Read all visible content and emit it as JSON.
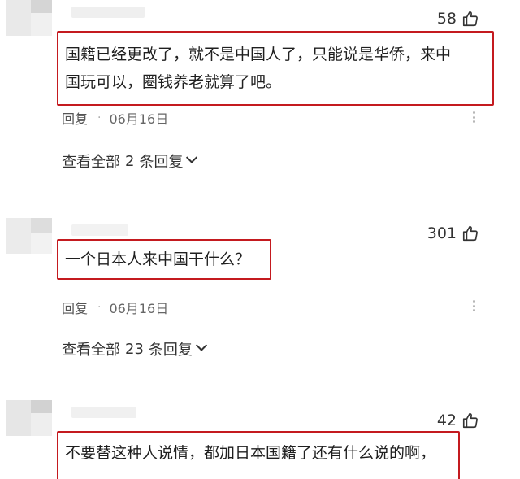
{
  "comments": [
    {
      "likes": "58",
      "text_line1": "国籍已经更改了，就不是中国人了，只能说是华侨，来中",
      "text_line2": "国玩可以，圈钱养老就算了吧。",
      "reply_label": "回复",
      "separator": "·",
      "date": "06月16日",
      "view_prefix": "查看全部",
      "reply_count": "2",
      "view_suffix": "条回复"
    },
    {
      "likes": "301",
      "text_line1": "一个日本人来中国干什么？",
      "reply_label": "回复",
      "separator": "·",
      "date": "06月16日",
      "view_prefix": "查看全部",
      "reply_count": "23",
      "view_suffix": "条回复"
    },
    {
      "likes": "42",
      "text_line1": "不要替这种人说情，都加日本国籍了还有什么说的啊，"
    }
  ],
  "icons": {
    "like": "thumbs-up-icon",
    "more": "more-vertical-icon",
    "expand": "chevron-down-icon"
  },
  "colors": {
    "highlight_border": "#c41a1f",
    "text": "#1f1f1f",
    "meta": "#666666"
  }
}
